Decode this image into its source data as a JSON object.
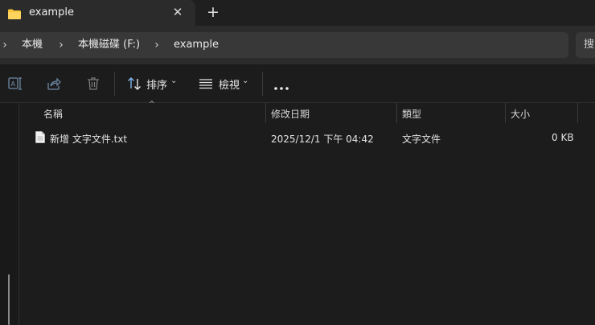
{
  "tab": {
    "title": "example",
    "close_glyph": "✕",
    "new_tab_glyph": "+",
    "icon": "folder-icon"
  },
  "breadcrumb": {
    "separator_glyph": "›",
    "items": [
      "本機",
      "本機磁碟 (F:)",
      "example"
    ]
  },
  "search": {
    "text": "搜"
  },
  "toolbar": {
    "sort_label": "排序",
    "view_label": "檢視",
    "dropdown_glyph": "⌄",
    "more_glyph": "•••",
    "icons": [
      "rename-icon",
      "share-icon",
      "delete-icon",
      "sort-icon",
      "view-icon",
      "more-icon"
    ]
  },
  "columns": {
    "name": "名稱",
    "modified": "修改日期",
    "type": "類型",
    "size": "大小",
    "sort_glyph": "^"
  },
  "files": [
    {
      "name": "新增 文字文件.txt",
      "modified": "2025/12/1 下午 04:42",
      "type": "文字文件",
      "size": "0 KB",
      "icon": "text-file-icon"
    }
  ],
  "colors": {
    "background": "#1c1c1c",
    "tab_active": "#2b2b2b",
    "address_bar": "#383838",
    "folder_yellow": "#f8c53b",
    "accent_blue": "#7fb4ea"
  }
}
